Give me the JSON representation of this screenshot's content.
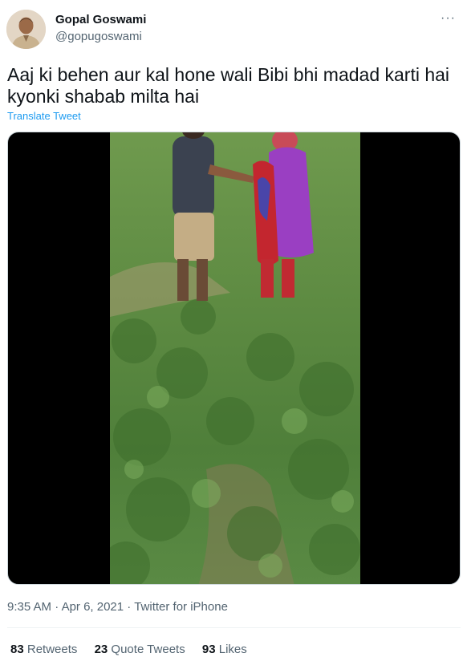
{
  "user": {
    "name": "Gopal Goswami",
    "handle": "@gopugoswami"
  },
  "more_icon": "more-dots-icon",
  "tweet": {
    "text_line1": "Aaj ki behen aur kal hone wali Bibi bhi madad karti hai",
    "text_line2": "kyonki shabab milta hai",
    "translate_label": "Translate Tweet"
  },
  "meta": {
    "time": "9:35 AM",
    "separator": " · ",
    "date": "Apr 6, 2021",
    "source": "Twitter for iPhone"
  },
  "stats": {
    "retweets_count": "83",
    "retweets_label": "Retweets",
    "quote_count": "23",
    "quote_label": "Quote Tweets",
    "likes_count": "93",
    "likes_label": "Likes"
  }
}
